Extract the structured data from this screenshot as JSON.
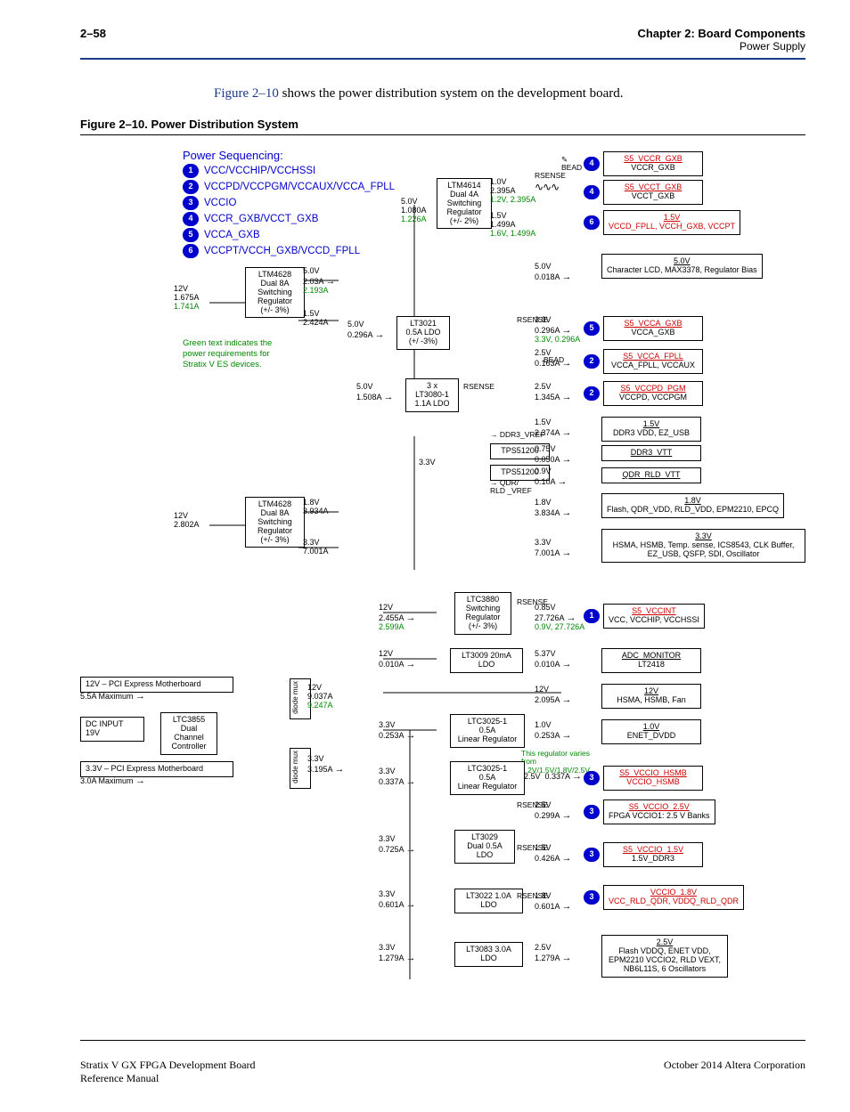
{
  "header": {
    "page_num": "2–58",
    "chapter": "Chapter 2: Board Components",
    "section": "Power Supply"
  },
  "intro": {
    "figref": "Figure 2–10",
    "rest": " shows the power distribution system on the development board."
  },
  "figure_caption": "Figure 2–10.  Power Distribution System",
  "sequencing": {
    "title": "Power Sequencing:",
    "items": [
      {
        "n": "1",
        "label": "VCC/VCCHIP/VCCHSSI"
      },
      {
        "n": "2",
        "label": "VCCPD/VCCPGM/VCCAUX/VCCA_FPLL"
      },
      {
        "n": "3",
        "label": "VCCIO"
      },
      {
        "n": "4",
        "label": "VCCR_GXB/VCCT_GXB"
      },
      {
        "n": "5",
        "label": "VCCA_GXB"
      },
      {
        "n": "6",
        "label": "VCCPT/VCCH_GXB/VCCD_FPLL"
      }
    ]
  },
  "green_note": "Green text indicates the power requirements for Stratix V ES devices.",
  "inputs": {
    "top12v": {
      "v": "12V",
      "a": "1.675A",
      "ag": "1.741A"
    },
    "bot12v": {
      "v": "12V",
      "a": "2.802A"
    },
    "pci_top": {
      "l1": "12V – PCI Express Motherboard",
      "l2": "5.5A Maximum"
    },
    "dcin": {
      "l1": "DC INPUT",
      "l2": "19V"
    },
    "pci_bot": {
      "l1": "3.3V – PCI Express Motherboard",
      "l2": "3.0A Maximum"
    }
  },
  "regs": {
    "ltm4628_a": {
      "l": [
        "LTM4628",
        "Dual 8A",
        "Switching",
        "Regulator",
        "(+/- 3%)"
      ]
    },
    "ltm4628_b": {
      "l": [
        "LTM4628",
        "Dual 8A",
        "Switching",
        "Regulator",
        "(+/- 3%)"
      ]
    },
    "ltm4614": {
      "l": [
        "LTM4614",
        "Dual 4A",
        "Switching",
        "Regulator",
        "(+/- 2%)"
      ]
    },
    "lt3021": {
      "l": [
        "LT3021",
        "0.5A LDO",
        "(+/ -3%)"
      ]
    },
    "lt3080": {
      "l": [
        "3 x",
        "LT3080-1",
        "1.1A LDO"
      ]
    },
    "tps_a": {
      "l": [
        "TPS51200"
      ]
    },
    "tps_b": {
      "l": [
        "TPS51200"
      ]
    },
    "ddr3vref": "DDR3_VREF",
    "qdrvref": "QDR/\nRLD _VREF",
    "ltc3880": {
      "l": [
        "LTC3880",
        "Switching",
        "Regulator",
        "(+/- 3%)"
      ]
    },
    "lt3009": {
      "l": [
        "LT3009 20mA",
        "LDO"
      ]
    },
    "ltc3025a": {
      "l": [
        "LTC3025-1",
        "0.5A",
        "Linear Regulator"
      ]
    },
    "ltc3025b": {
      "l": [
        "LTC3025-1",
        "0.5A",
        "Linear Regulator"
      ]
    },
    "lt3029": {
      "l": [
        "LT3029",
        "Dual 0.5A",
        "LDO"
      ]
    },
    "lt3022": {
      "l": [
        "LT3022 1.0A",
        "LDO"
      ]
    },
    "lt3083": {
      "l": [
        "LT3083 3.0A",
        "LDO"
      ]
    },
    "ltc3855": {
      "l": [
        "LTC3855",
        "Dual",
        "Channel",
        "Controller"
      ]
    }
  },
  "mids": {
    "a5v_1080": {
      "t": "5.0V",
      "b": "1.080A",
      "bg": "1.226A"
    },
    "a5v_203": {
      "t": "5.0V",
      "b": "2.03A",
      "bg": "2.193A"
    },
    "a15v_2424": {
      "t": "1.5V",
      "b": "2.424A"
    },
    "a5v_0296": {
      "t": "5.0V",
      "b": "0.296A"
    },
    "a5v_1508": {
      "t": "5.0V",
      "b": "1.508A"
    },
    "a33": {
      "t": "3.3V"
    },
    "a18_3934": {
      "t": "1.8V",
      "b": "3.934A"
    },
    "a33_7001": {
      "t": "3.3V",
      "b": "7.001A"
    },
    "a12v_2455": {
      "t": "12V",
      "b": "2.455A",
      "bg": "2.599A"
    },
    "a12v_0010": {
      "t": "12V",
      "b": "0.010A"
    },
    "a12v_9037": {
      "t": "12V",
      "b": "9.037A",
      "bg": "9.247A"
    },
    "a33_0253": {
      "t": "3.3V",
      "b": "0.253A"
    },
    "a33_3195": {
      "t": "3.3V",
      "b": "3.195A"
    },
    "a33_0337": {
      "t": "3.3V",
      "b": "0.337A"
    },
    "a33_0725": {
      "t": "3.3V",
      "b": "0.725A"
    },
    "a33_0601": {
      "t": "3.3V",
      "b": "0.601A"
    },
    "a33_1279": {
      "t": "3.3V",
      "b": "1.279A"
    },
    "diodemux1": "diode mux",
    "diodemux2": "diode mux"
  },
  "outs": {
    "o10_2395": {
      "t": "1.0V",
      "b": "2.395A",
      "bg": "1.2V, 2.395A"
    },
    "o15_1499": {
      "t": "1.5V",
      "b": "1.499A",
      "bg": "1.6V, 1.499A"
    },
    "o50_0018": {
      "t": "5.0V",
      "b": "0.018A"
    },
    "o30_0296": {
      "t": "3.0V",
      "b": "0.296A",
      "bg": "3.3V, 0.296A"
    },
    "o25_0163": {
      "t": "2.5V",
      "b": "0.163A"
    },
    "o25_1345": {
      "t": "2.5V",
      "b": "1.345A"
    },
    "o15_2374": {
      "t": "1.5V",
      "b": "2.374A"
    },
    "o075_0050": {
      "t": "0.75V",
      "b": "0.050A"
    },
    "o09_010": {
      "t": "0.9V",
      "b": "0.10A"
    },
    "o18_3834": {
      "t": "1.8V",
      "b": "3.834A"
    },
    "o33_7001": {
      "t": "3.3V",
      "b": "7.001A"
    },
    "o085_27": {
      "t": "0.85V",
      "b": "27.726A",
      "bg": "0.9V, 27.726A"
    },
    "o537_0010": {
      "t": "5.37V",
      "b": "0.010A"
    },
    "o12_2095": {
      "t": "12V",
      "b": "2.095A"
    },
    "o10_0253": {
      "t": "1.0V",
      "b": "0.253A"
    },
    "note_reg": "This regulator varies from 1.2V/1.5V/1.8V/2.5V",
    "o25_0337": {
      "t": "2.5V",
      "b": "0.337A"
    },
    "o25_0299": {
      "t": "2.5V",
      "b": "0.299A"
    },
    "o15_0426": {
      "t": "1.5V",
      "b": "0.426A"
    },
    "o18_0601": {
      "t": "1.8V",
      "b": "0.601A"
    },
    "o25_1279": {
      "t": "2.5V",
      "b": "1.279A"
    }
  },
  "rails": {
    "r1": {
      "pill": "4",
      "u": "S5_VCCR_GXB",
      "b": "VCCR_GXB"
    },
    "r2": {
      "pill": "4",
      "u": "S5_VCCT_GXB",
      "b": "VCCT_GXB"
    },
    "r3": {
      "pill": "6",
      "u": "1.5V",
      "b": "VCCD_FPLL, VCCH_GXB, VCCPT"
    },
    "r4": {
      "u": "5.0V",
      "b": "Character LCD, MAX3378, Regulator Bias"
    },
    "r5": {
      "pill": "5",
      "u": "S5_VCCA_GXB",
      "b": "VCCA_GXB"
    },
    "r6": {
      "pill": "2",
      "u": "S5_VCCA_FPLL",
      "b": "VCCA_FPLL, VCCAUX"
    },
    "r7": {
      "pill": "2",
      "u": "S5_VCCPD_PGM",
      "b": "VCCPD, VCCPGM"
    },
    "r8": {
      "u": "1.5V",
      "b": "DDR3 VDD, EZ_USB"
    },
    "r9": {
      "u": "DDR3_VTT"
    },
    "r10": {
      "u": "QDR_RLD_VTT"
    },
    "r11": {
      "u": "1.8V",
      "b": "Flash, QDR_VDD, RLD_VDD, EPM2210, EPCQ"
    },
    "r12": {
      "u": "3.3V",
      "b": "HSMA, HSMB, Temp. sense, ICS8543, CLK Buffer, EZ_USB, QSFP, SDI, Oscillator"
    },
    "r13": {
      "pill": "1",
      "u": "S5_VCCINT",
      "b": "VCC, VCCHIP, VCCHSSI"
    },
    "r14": {
      "u": "ADC_MONITOR",
      "b": "LT2418"
    },
    "r15": {
      "u": "12V",
      "b": "HSMA, HSMB, Fan"
    },
    "r16": {
      "u": "1.0V",
      "b": "ENET_DVDD"
    },
    "r17": {
      "pill": "3",
      "u": "S5_VCCIO_HSMB",
      "b": "VCCIO_HSMB"
    },
    "r18": {
      "pill": "3",
      "u": "S5_VCCIO_2.5V",
      "b": "FPGA VCCIO1: 2.5 V Banks"
    },
    "r19": {
      "pill": "3",
      "u": "S5_VCCIO_1.5V",
      "b": "1.5V_DDR3"
    },
    "r20": {
      "pill": "3",
      "u": "VCCIO_1.8V",
      "b": "VCC_RLD_QDR, VDDQ_RLD_QDR"
    },
    "r21": {
      "u": "2.5V",
      "b": "Flash VDDQ, ENET VDD, EPM2210 VCCIO2, RLD VEXT, NB6L11S, 6 Oscillators"
    }
  },
  "labels": {
    "bead": "BEAD",
    "rsense": "RSENSE"
  },
  "footer": {
    "left1": "Stratix V GX FPGA Development Board",
    "left2": "Reference Manual",
    "right": "October 2014   Altera Corporation"
  }
}
